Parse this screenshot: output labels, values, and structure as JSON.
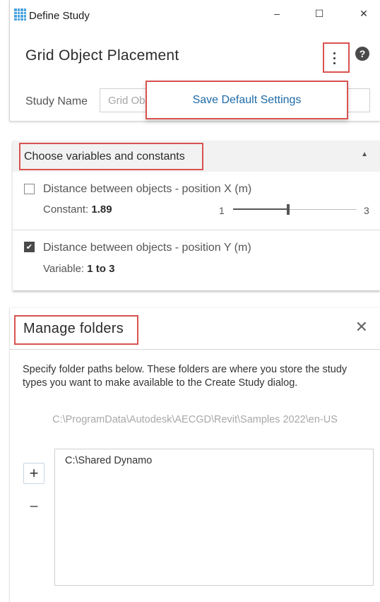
{
  "window": {
    "title": "Define Study",
    "minimize_glyph": "–",
    "maximize_glyph": "☐",
    "close_glyph": "✕"
  },
  "define_study": {
    "heading": "Grid Object Placement",
    "help_glyph": "?",
    "study_name_label": "Study Name",
    "study_name_value": "Grid Ob",
    "menu_item": "Save Default Settings"
  },
  "variables_panel": {
    "title": "Choose variables and constants",
    "collapse_glyph": "▲",
    "items": [
      {
        "label": "Distance between objects - position X (m)",
        "checked": false,
        "sub_prefix": "Constant: ",
        "sub_value": "1.89",
        "slider": {
          "min": "1",
          "max": "3",
          "fraction": 0.445
        }
      },
      {
        "label": "Distance between objects - position Y (m)",
        "checked": true,
        "check_glyph": "✔",
        "sub_prefix": "Variable: ",
        "sub_value": "1 to 3"
      }
    ]
  },
  "manage_folders": {
    "title": "Manage folders",
    "close_glyph": "✕",
    "description": "Specify folder paths below. These folders are where you store the study types you want to make available to the Create Study dialog.",
    "default_path": "C:\\ProgramData\\Autodesk\\AECGD\\Revit\\Samples 2022\\en-US",
    "add_glyph": "+",
    "remove_glyph": "−",
    "folders": [
      "C:\\Shared Dynamo"
    ]
  },
  "colors": {
    "highlight": "#d9534f",
    "link": "#1d6aa8",
    "header_bg": "#f2f2f2"
  },
  "icons": [
    "app-grid-icon",
    "kebab-menu-icon",
    "help-icon",
    "caret-up-icon",
    "close-icon",
    "plus-icon",
    "minus-icon",
    "checkmark-icon"
  ]
}
